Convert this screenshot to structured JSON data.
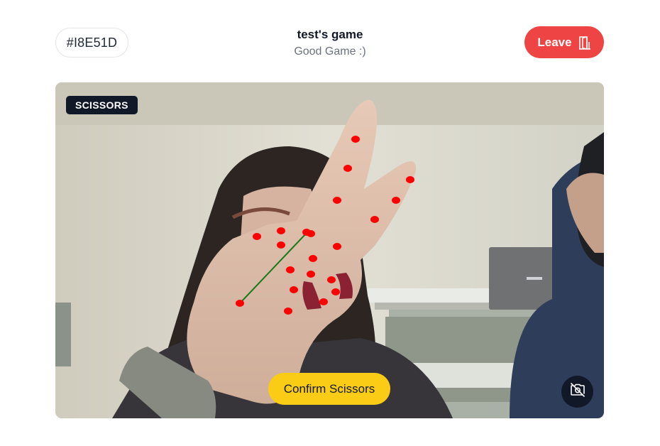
{
  "header": {
    "room_code": "#I8E51D",
    "game_title": "test's game",
    "game_subtitle": "Good Game :)",
    "leave_label": "Leave"
  },
  "camera": {
    "gesture_badge": "SCISSORS",
    "confirm_label": "Confirm Scissors",
    "toggle_icon": "camera-off-icon"
  },
  "colors": {
    "leave": "#ef4444",
    "confirm": "#facc15",
    "badge": "#111827",
    "landmark": "#ff0000",
    "connector": "#1a7a1a"
  }
}
